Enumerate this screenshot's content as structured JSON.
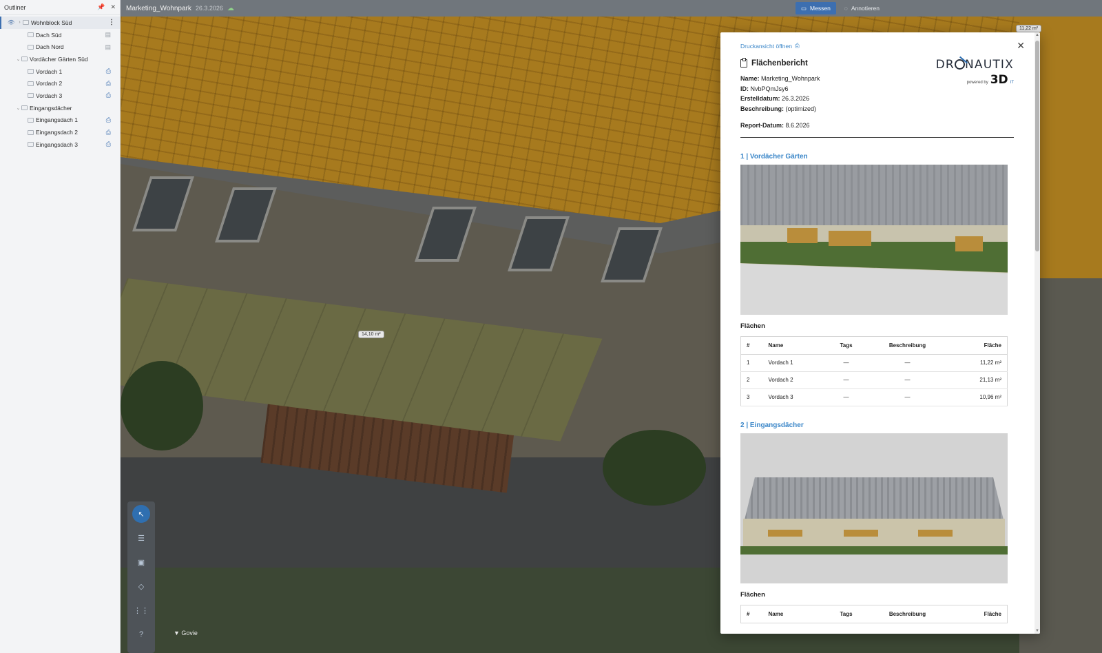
{
  "outliner": {
    "title": "Outliner",
    "pin_icon": "pin-icon",
    "close_icon": "close-icon",
    "items": [
      {
        "label": "Wohnblock Süd",
        "level": 0
      },
      {
        "label": "Dach Süd",
        "level": 1
      },
      {
        "label": "Dach Nord",
        "level": 1
      },
      {
        "label": "Vordächer Gärten Süd",
        "level": 0
      },
      {
        "label": "Vordach 1",
        "level": 1
      },
      {
        "label": "Vordach 2",
        "level": 1
      },
      {
        "label": "Vordach 3",
        "level": 1
      },
      {
        "label": "Eingangsdächer",
        "level": 0
      },
      {
        "label": "Eingangsdach 1",
        "level": 1
      },
      {
        "label": "Eingangsdach 2",
        "level": 1
      },
      {
        "label": "Eingangsdach 3",
        "level": 1
      }
    ]
  },
  "topbar": {
    "project": "Marketing_Wohnpark",
    "date": "26.3.2026",
    "measure": "Messen",
    "annotate": "Annotieren"
  },
  "viewport": {
    "label_canopy": "14,10 m²",
    "label_corner": "11,22 m²",
    "brand": "Govie"
  },
  "report": {
    "print_link": "Druckansicht öffnen",
    "title": "Flächenbericht",
    "name_label": "Name:",
    "name": "Marketing_Wohnpark",
    "id_label": "ID:",
    "id": "NvbPQmJsy6",
    "created_label": "Erstelldatum:",
    "created": "26.3.2026",
    "desc_label": "Beschreibung:",
    "desc": "(optimized)",
    "report_date_label": "Report-Datum:",
    "report_date": "8.6.2026",
    "logo_word_a": "DR",
    "logo_word_b": "NAUTIX",
    "logo_powered": "powered by",
    "logo_3d": "3D",
    "logo_it": "IT",
    "sections": [
      {
        "title": "1 | Vordächer Gärten",
        "table_title": "Flächen",
        "headers": [
          "#",
          "Name",
          "Tags",
          "Beschreibung",
          "Fläche"
        ],
        "rows": [
          [
            "1",
            "Vordach 1",
            "—",
            "—",
            "11,22 m²"
          ],
          [
            "2",
            "Vordach 2",
            "—",
            "—",
            "21,13 m²"
          ],
          [
            "3",
            "Vordach 3",
            "—",
            "—",
            "10,96 m²"
          ]
        ]
      },
      {
        "title": "2 | Eingangsdächer",
        "table_title": "Flächen",
        "headers": [
          "#",
          "Name",
          "Tags",
          "Beschreibung",
          "Fläche"
        ]
      }
    ]
  },
  "colors": {
    "accent": "#3d6fb0",
    "link": "#3a86c8"
  }
}
